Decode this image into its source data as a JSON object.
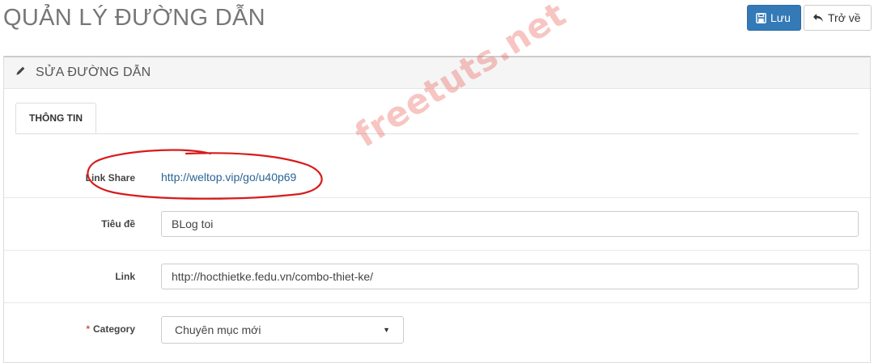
{
  "header": {
    "title": "QUẢN LÝ ĐƯỜNG DẪN",
    "save_label": "Lưu",
    "back_label": "Trở về"
  },
  "panel": {
    "title": "SỬA ĐƯỜNG DẪN",
    "tabs": [
      {
        "label": "THÔNG TIN",
        "active": true
      }
    ]
  },
  "form": {
    "link_share": {
      "label": "Link Share",
      "value": "http://weltop.vip/go/u40p69"
    },
    "title": {
      "label": "Tiêu đề",
      "value": "BLog toi"
    },
    "link": {
      "label": "Link",
      "value": "http://hocthietke.fedu.vn/combo-thiet-ke/"
    },
    "category": {
      "label": "Category",
      "required": true,
      "selected": "Chuyên mục mới"
    }
  },
  "watermark": "freetuts.net",
  "colors": {
    "primary": "#337ab7",
    "link": "#2a6496",
    "required": "#d9534f",
    "annotation": "#d81b1b"
  }
}
